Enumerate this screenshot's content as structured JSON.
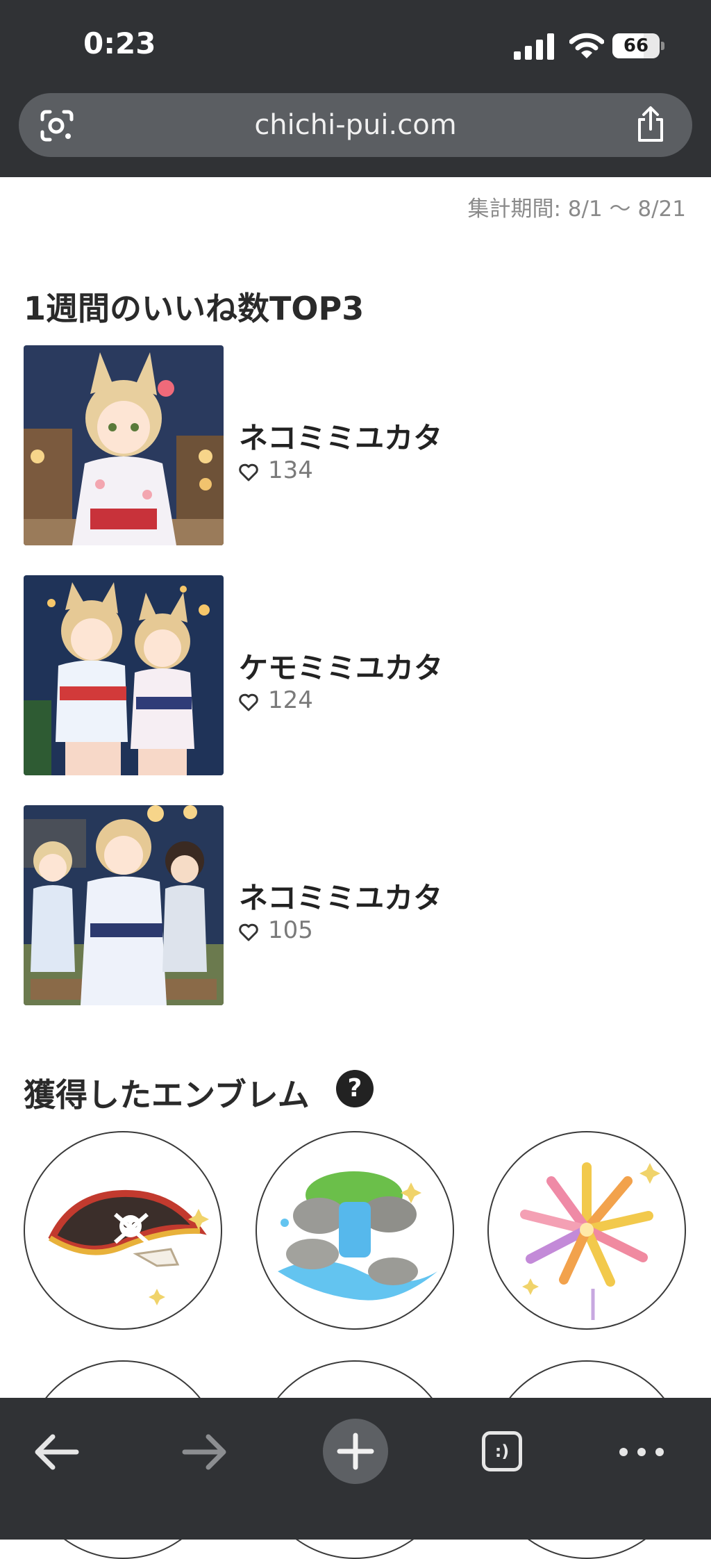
{
  "status_bar": {
    "time": "0:23",
    "battery": "66",
    "battery_level": 0.66
  },
  "browser": {
    "url": "chichi-pui.com"
  },
  "page": {
    "period": "集計期間: 8/1 〜 8/21",
    "top_section_title": "1週間のいいね数TOP3",
    "top_items": [
      {
        "title": "ネコミミユカタ",
        "likes": "134"
      },
      {
        "title": "ケモミミユカタ",
        "likes": "124"
      },
      {
        "title": "ネコミミユカタ",
        "likes": "105"
      }
    ],
    "emblem_section_title": "獲得したエンブレム",
    "help": "?",
    "emblems": [
      "pirate-hat-icon",
      "waterfall-icon",
      "fireworks-icon"
    ]
  },
  "toolbar": {
    "tab_label": ":)",
    "icons": [
      "back-arrow-icon",
      "forward-arrow-icon",
      "plus-icon",
      "tab-switcher-icon",
      "more-icon"
    ]
  },
  "colors": {
    "chrome": "#303235",
    "url_bar": "#5b5e62",
    "accent_dark": "#222222"
  }
}
